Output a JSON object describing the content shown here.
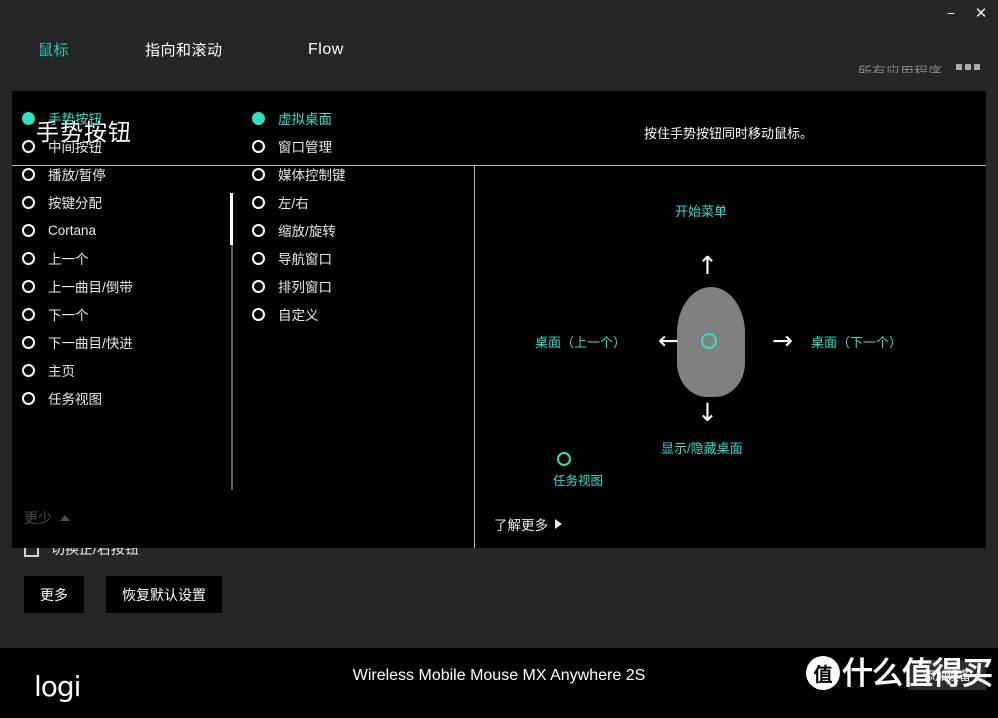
{
  "window": {
    "minimize_label": "−",
    "close_label": "✕"
  },
  "tabs": [
    {
      "label": "鼠标",
      "active": true
    },
    {
      "label": "指向和滚动",
      "active": false
    },
    {
      "label": "Flow",
      "active": false
    }
  ],
  "header": {
    "all_apps_label": "所有应用程序",
    "grid_icon": "grid-icon"
  },
  "panel": {
    "title": "手势按钮",
    "hint": "按住手势按钮同时移动鼠标。",
    "less_label": "更少",
    "less_chevron_icon": "chevron-up-icon",
    "learn_more_label": "了解更多",
    "learn_more_chevron_icon": "chevron-right-icon"
  },
  "primary_list": {
    "items": [
      {
        "label": "手势按钮",
        "selected": true
      },
      {
        "label": "中间按钮",
        "selected": false
      },
      {
        "label": "播放/暂停",
        "selected": false
      },
      {
        "label": "按键分配",
        "selected": false
      },
      {
        "label": "Cortana",
        "selected": false
      },
      {
        "label": "上一个",
        "selected": false
      },
      {
        "label": "上一曲目/倒带",
        "selected": false
      },
      {
        "label": "下一个",
        "selected": false
      },
      {
        "label": "下一曲目/快进",
        "selected": false
      },
      {
        "label": "主页",
        "selected": false
      },
      {
        "label": "任务视图",
        "selected": false
      }
    ]
  },
  "secondary_list": {
    "items": [
      {
        "label": "虚拟桌面",
        "selected": true
      },
      {
        "label": "窗口管理",
        "selected": false
      },
      {
        "label": "媒体控制键",
        "selected": false
      },
      {
        "label": "左/右",
        "selected": false
      },
      {
        "label": "缩放/旋转",
        "selected": false
      },
      {
        "label": "导航窗口",
        "selected": false
      },
      {
        "label": "排列窗口",
        "selected": false
      },
      {
        "label": "自定义",
        "selected": false
      }
    ]
  },
  "diagram": {
    "up_label": "开始菜单",
    "down_label": "显示/隐藏桌面",
    "left_label": "桌面（上一个）",
    "right_label": "桌面（下一个）",
    "center_label": "任务视图",
    "arrow_up_icon": "arrow-up-icon",
    "arrow_down_icon": "arrow-down-icon",
    "arrow_left_icon": "arrow-left-icon",
    "arrow_right_icon": "arrow-right-icon",
    "arrow_up": "↑",
    "arrow_down": "↓",
    "arrow_left": "←",
    "arrow_right": "→"
  },
  "background": {
    "checkbox_label": "切换正/右按钮",
    "buttons": [
      {
        "label": "更多"
      },
      {
        "label": "恢复默认设置"
      }
    ]
  },
  "footer": {
    "brand": "logi",
    "device_name": "Wireless Mobile Mouse MX Anywhere 2S",
    "add_device_label": "添加设备"
  },
  "watermark": {
    "badge": "值",
    "text": "什么值得买"
  },
  "colors": {
    "accent_teal": "#2ee0c4",
    "tab_active": "#2ec8b0",
    "panel_bg": "#000000",
    "window_bg": "#242628",
    "mouse_gray": "#808080"
  }
}
